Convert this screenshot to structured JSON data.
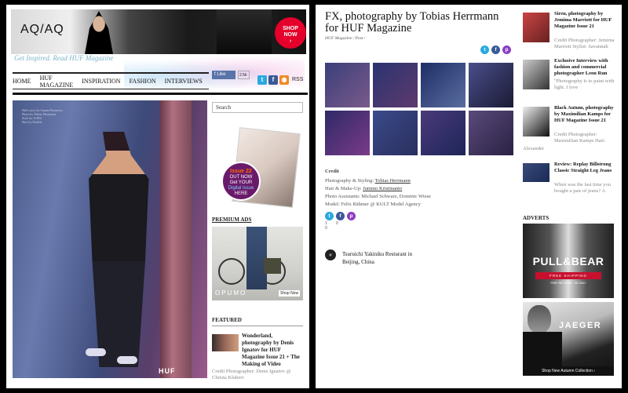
{
  "left": {
    "banner": {
      "logo": "AQ/AQ",
      "cta_line1": "SHOP",
      "cta_line2": "NOW",
      "cta_arrow": "›"
    },
    "tagline": "Get Inspired. Read HUF Magazine",
    "nav": [
      "HOME",
      "HUF MAGAZINE",
      "INSPIRATION",
      "FASHION",
      "INTERVIEWS"
    ],
    "social": {
      "like_label": "Like",
      "like_count": "2.5k",
      "rss_label": "RSS"
    },
    "hero_credit": "Huf's story by Suzane Brouwers\nPhoto by Tobias Herrmann\nStyle by AOHA\nShot by Models",
    "hero_brand": "HUF",
    "search_placeholder": "Search",
    "mag_promo": {
      "issue": "Issue 22",
      "line2": "OUT NOW",
      "line3": "Get YOUR",
      "line4": "Digital Issue",
      "line5": "HERE"
    },
    "premium_ads": "PREMIUM ADS",
    "opumo": {
      "brand": "OPUMO",
      "shop": "Shop Now"
    },
    "featured_heading": "FEATURED",
    "featured_item": {
      "title": "Wonderland, photography by Denis Ignatov for HUF Magazine Issue 21 + The Making of Video",
      "sub": "Credit Photographer: Denis Ignatov @ Christa Klubert"
    }
  },
  "right": {
    "title": "FX, photography by Tobias Herrmann for HUF Magazine",
    "meta": "HUF Magazine / Post /",
    "gallery_colors": [
      [
        "#3b3f7a",
        "#7a5a8a"
      ],
      [
        "#2a3370",
        "#5e3a6e"
      ],
      [
        "#1e2e66",
        "#5a6da0"
      ],
      [
        "#4a4e8a",
        "#1a1a33"
      ],
      [
        "#2e2a66",
        "#7a3a8a"
      ],
      [
        "#3a4a8a",
        "#2a2f5e"
      ],
      [
        "#4a3a7a",
        "#1e2558"
      ],
      [
        "#5a4a7a",
        "#2a2244"
      ]
    ],
    "credit": {
      "heading": "Credit",
      "l1_label": "Photography & Styling: ",
      "l1_link": "Tobias Herrmann",
      "l2_label": "Hair & Make-Up: ",
      "l2_link": "Jumino Kristinanto",
      "l3": "Photo Assistants: Michael Schwarz, Dominic Wiese",
      "l4": "Model: Felix Rähmer @  KULT Model Agency"
    },
    "share_counts": [
      "1",
      "0",
      "0"
    ],
    "prev_post": "Tsuruichi Yakiniku Resturant in Beijing, China",
    "sidebar": [
      {
        "title": "Siren, photography by Jemima Marriott for HUF Magazine Issue 21",
        "desc": "Credit Photographer: Jemima Marriott Stylist: Savannah",
        "colors": [
          "#c44",
          "#622"
        ]
      },
      {
        "title": "Exclusive Interview with fashion and commercial photographer Leon Run",
        "desc": "\"Photography is to paint with light. I love",
        "colors": [
          "#ccc",
          "#333"
        ]
      },
      {
        "title": "Black Autum, photography by Maximilian Kamps for HUF Magazine Issue 21",
        "desc": "Credit Photographer: Maximilian Kamps Hair:",
        "tail": "Alexander",
        "colors": [
          "#eee",
          "#111"
        ]
      },
      {
        "title": "Review: Replay Billstrong Classic Straight Leg Jeans",
        "desc": "When was the last time you bought a pair of jeans? A",
        "colors": [
          "#3a4a7a",
          "#1a2a55"
        ]
      }
    ],
    "adverts_heading": "ADVERTS",
    "pullbear": {
      "logo": "PULL&BEAR",
      "bar": "FREE SHIPPING",
      "small": "FREE RETURNS   ·   UK ONLY"
    },
    "jaeger": {
      "logo": "JAEGER",
      "bottom": "Shop New Autumn Collection ›"
    }
  }
}
